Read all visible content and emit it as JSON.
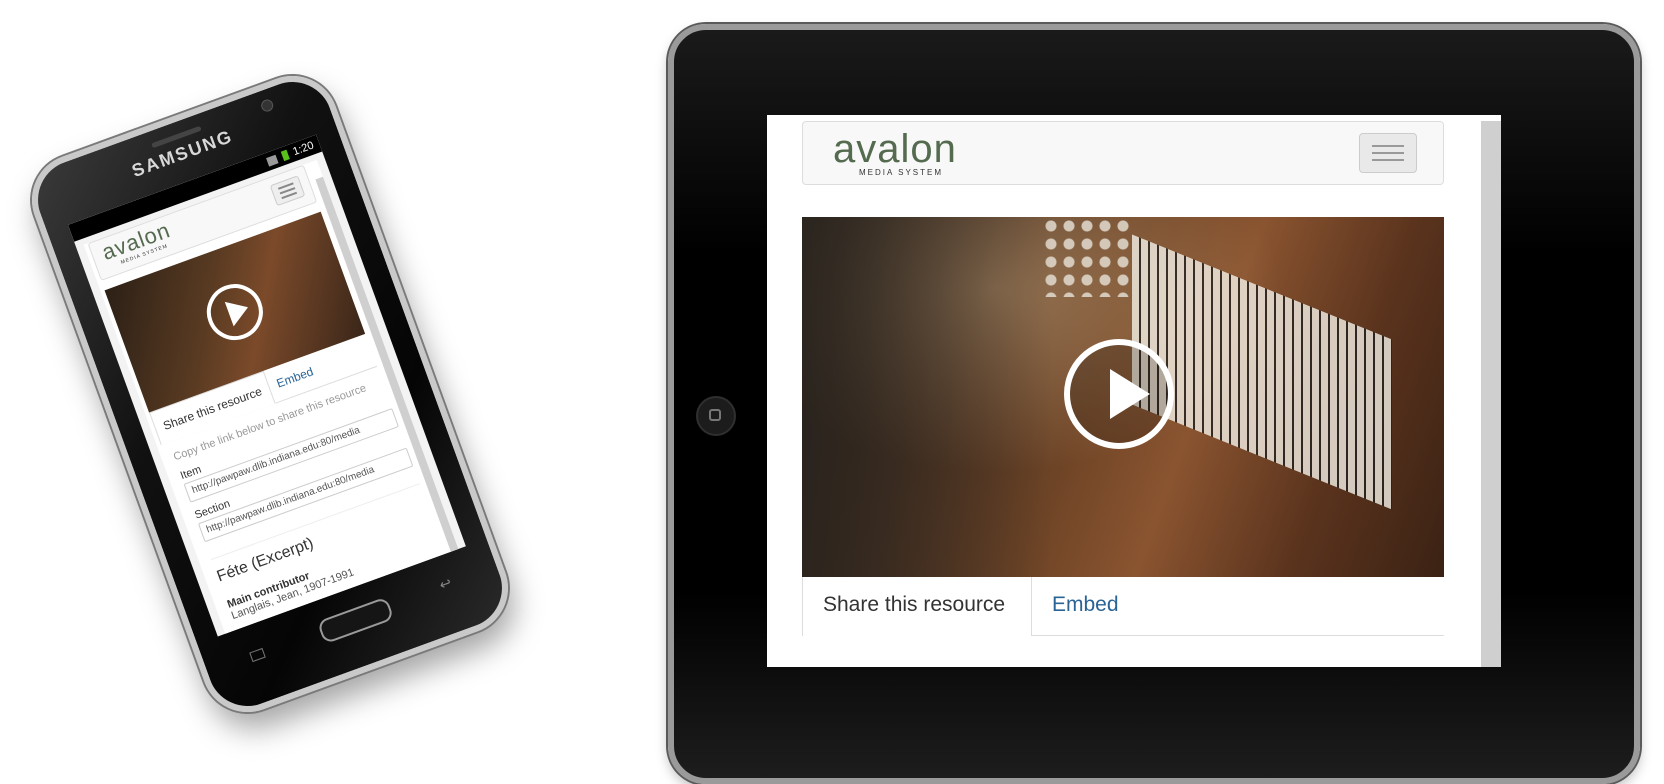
{
  "phone": {
    "brand": "SAMSUNG",
    "status_time": "1:20",
    "logo": "avalon",
    "logo_sub": "MEDIA SYSTEM",
    "tabs": [
      {
        "label": "Share this resource",
        "active": true
      },
      {
        "label": "Embed",
        "active": false
      }
    ],
    "share_intro": "Copy the link below to share this resource",
    "item_label": "Item",
    "item_url": "http://pawpaw.dlib.indiana.edu:80/media",
    "section_label": "Section",
    "section_url": "http://pawpaw.dlib.indiana.edu:80/media",
    "title": "Féte (Excerpt)",
    "main_contributor_label": "Main contributor",
    "main_contributor": "Langlais, Jean, 1907-1991"
  },
  "tablet": {
    "logo": "avalon",
    "logo_sub": "MEDIA SYSTEM",
    "tabs": [
      {
        "label": "Share this resource",
        "active": true
      },
      {
        "label": "Embed",
        "active": false
      }
    ]
  },
  "colors": {
    "logo": "#556b50",
    "link": "#2a6496",
    "battery": "#58c21a"
  }
}
